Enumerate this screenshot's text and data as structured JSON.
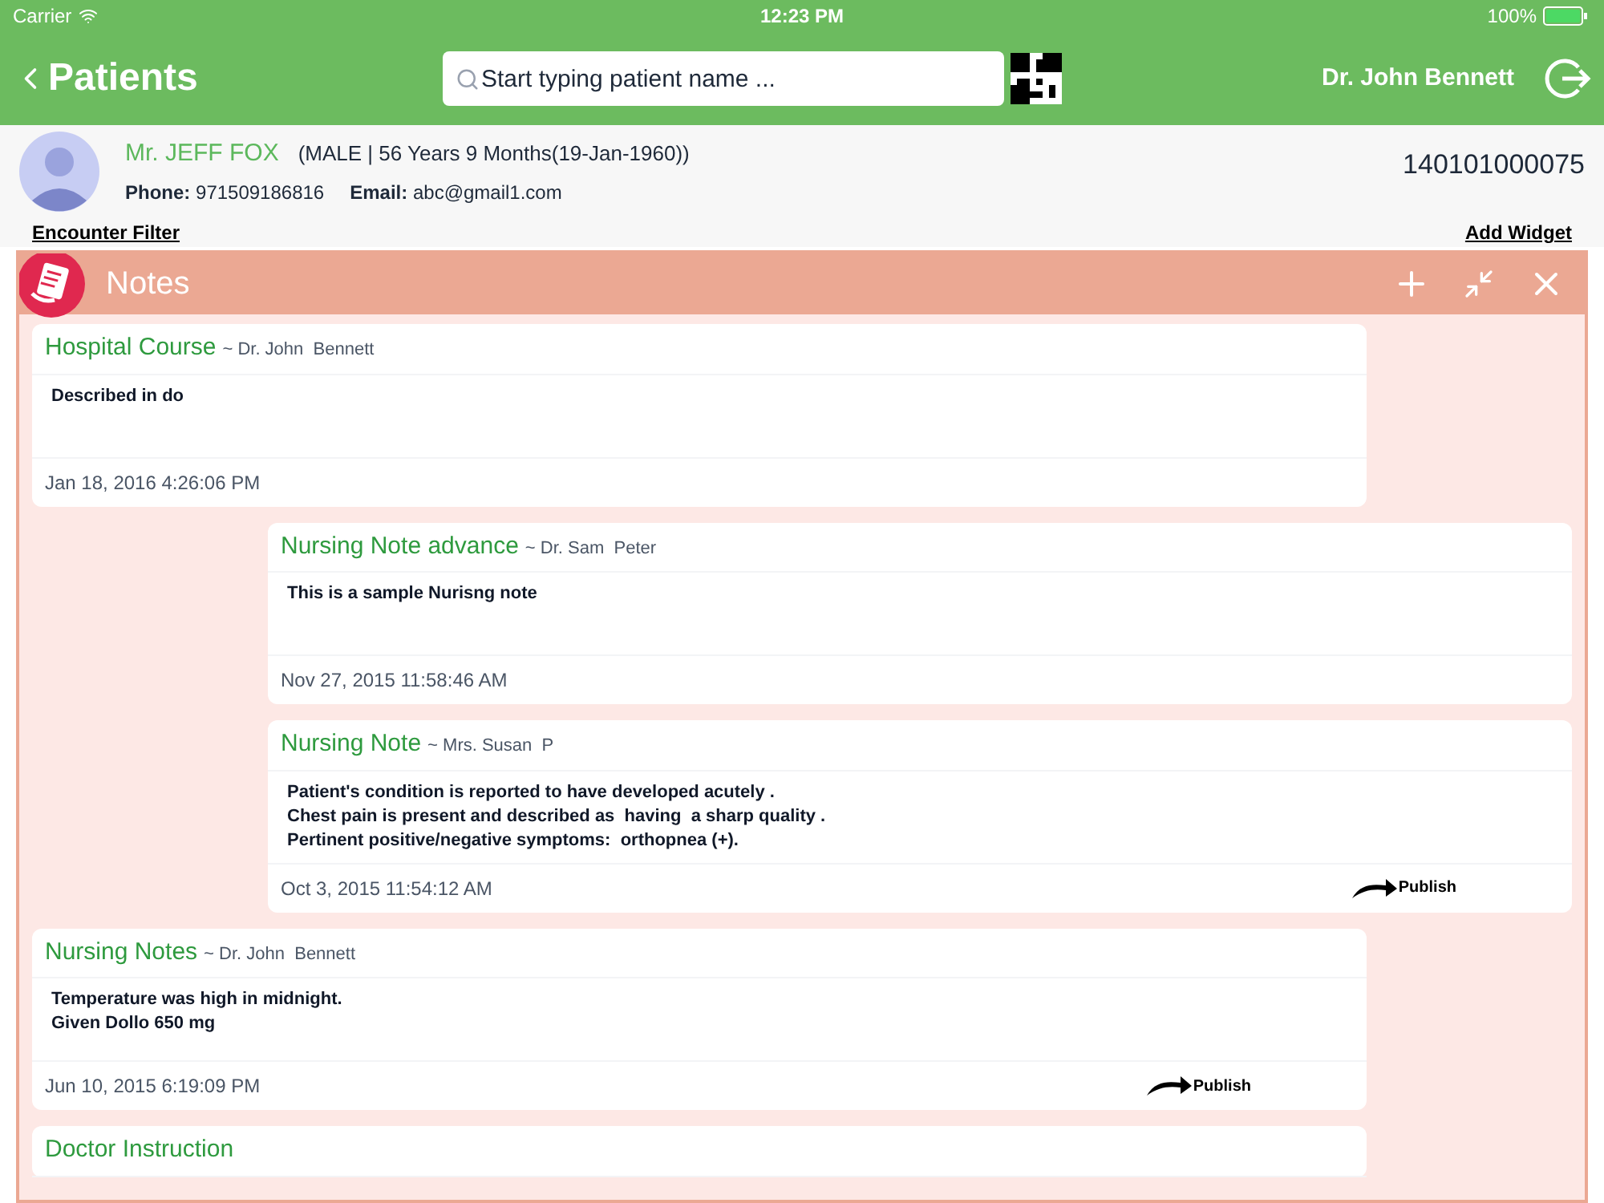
{
  "status_bar": {
    "carrier": "Carrier",
    "time": "12:23 PM",
    "battery": "100%"
  },
  "nav": {
    "back": "Patients",
    "search": {
      "placeholder": "Start typing patient name ..."
    },
    "user": "Dr. John Bennett"
  },
  "patient": {
    "name": "Mr. JEFF FOX",
    "details": "(MALE | 56 Years 9 Months(19-Jan-1960))",
    "phone_label": "Phone:",
    "phone": "971509186816",
    "email_label": "Email:",
    "email": "abc@gmail1.com",
    "id": "140101000075"
  },
  "links": {
    "filter": "Encounter Filter",
    "add_widget": "Add Widget"
  },
  "notes_panel": {
    "title": "Notes",
    "notes": [
      {
        "kind": "left",
        "title": "Hospital Course",
        "author": "~ Dr. John  Bennett",
        "body": [
          "Described in do"
        ],
        "date": "Jan 18, 2016 4:26:06 PM"
      },
      {
        "kind": "right",
        "title": "Nursing Note advance",
        "author": "~ Dr. Sam  Peter",
        "body": [
          "This is a sample Nurisng note"
        ],
        "date": "Nov 27, 2015 11:58:46 AM"
      },
      {
        "kind": "right",
        "title": "Nursing Note",
        "author": "~ Mrs. Susan  P",
        "body": [
          "Patient's condition is reported to have developed acutely .",
          "Chest pain is present and described as  having  a sharp quality .",
          "Pertinent positive/negative symptoms:  orthopnea (+)."
        ],
        "date": "Oct 3, 2015 11:54:12 AM",
        "publish": "Publish"
      },
      {
        "kind": "left",
        "title": "Nursing Notes",
        "author": "~ Dr. John  Bennett",
        "body": [
          "Temperature was high in midnight.",
          "Given Dollo 650 mg"
        ],
        "date": "Jun 10, 2015 6:19:09 PM",
        "publish": "Publish"
      },
      {
        "kind": "left",
        "title": "Doctor Instruction"
      }
    ]
  }
}
